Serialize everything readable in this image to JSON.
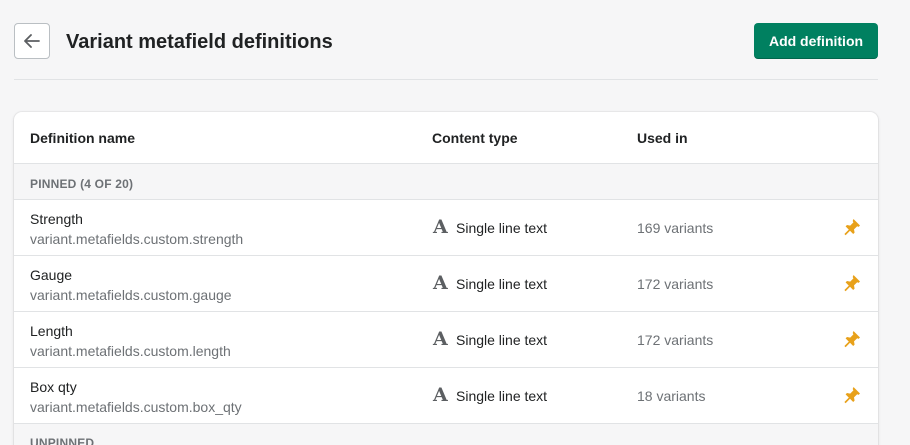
{
  "header": {
    "title": "Variant metafield definitions",
    "add_button_label": "Add definition",
    "back_icon": "arrow-left-icon"
  },
  "table": {
    "columns": [
      "Definition name",
      "Content type",
      "Used in"
    ],
    "pinned_section_label": "PINNED (4 OF 20)",
    "unpinned_section_label": "UNPINNED",
    "rows": [
      {
        "name": "Strength",
        "key": "variant.metafields.custom.strength",
        "type": "Single line text",
        "used": "169 variants"
      },
      {
        "name": "Gauge",
        "key": "variant.metafields.custom.gauge",
        "type": "Single line text",
        "used": "172 variants"
      },
      {
        "name": "Length",
        "key": "variant.metafields.custom.length",
        "type": "Single line text",
        "used": "172 variants"
      },
      {
        "name": "Box qty",
        "key": "variant.metafields.custom.box_qty",
        "type": "Single line text",
        "used": "18 variants"
      }
    ],
    "type_icon_glyph": "A",
    "pin_color": "#e8a11a"
  },
  "colors": {
    "primary": "#008060",
    "background": "#f6f6f7"
  }
}
